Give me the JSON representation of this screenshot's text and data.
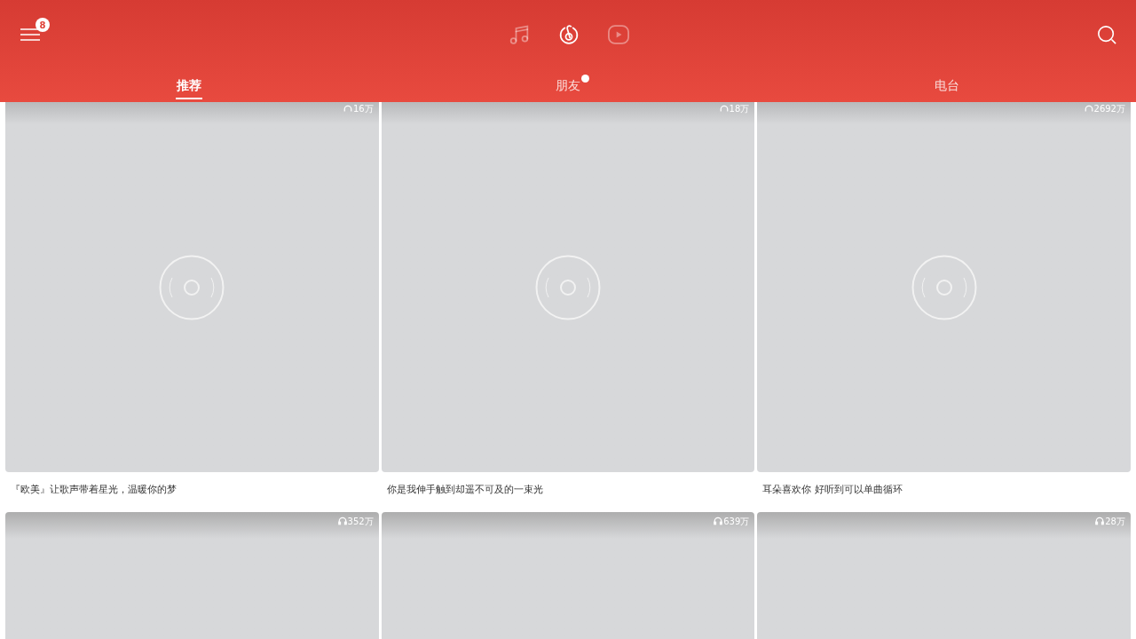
{
  "header": {
    "menu_badge": "8",
    "top_icons": [
      {
        "kind": "music",
        "selected": false
      },
      {
        "kind": "logo",
        "selected": true
      },
      {
        "kind": "video",
        "selected": false
      }
    ]
  },
  "tabs": [
    {
      "label": "推荐",
      "selected": true,
      "dot": false
    },
    {
      "label": "朋友",
      "selected": false,
      "dot": true
    },
    {
      "label": "电台",
      "selected": false,
      "dot": false
    }
  ],
  "playlists": [
    {
      "plays": "16万",
      "title": "『欧美』让歌声带着星光，温暖你的梦"
    },
    {
      "plays": "18万",
      "title": "你是我伸手触到却遥不可及的一束光"
    },
    {
      "plays": "2692万",
      "title": "耳朵喜欢你 好听到可以单曲循环"
    },
    {
      "plays": "352万"
    },
    {
      "plays": "639万"
    },
    {
      "plays": "28万"
    }
  ]
}
